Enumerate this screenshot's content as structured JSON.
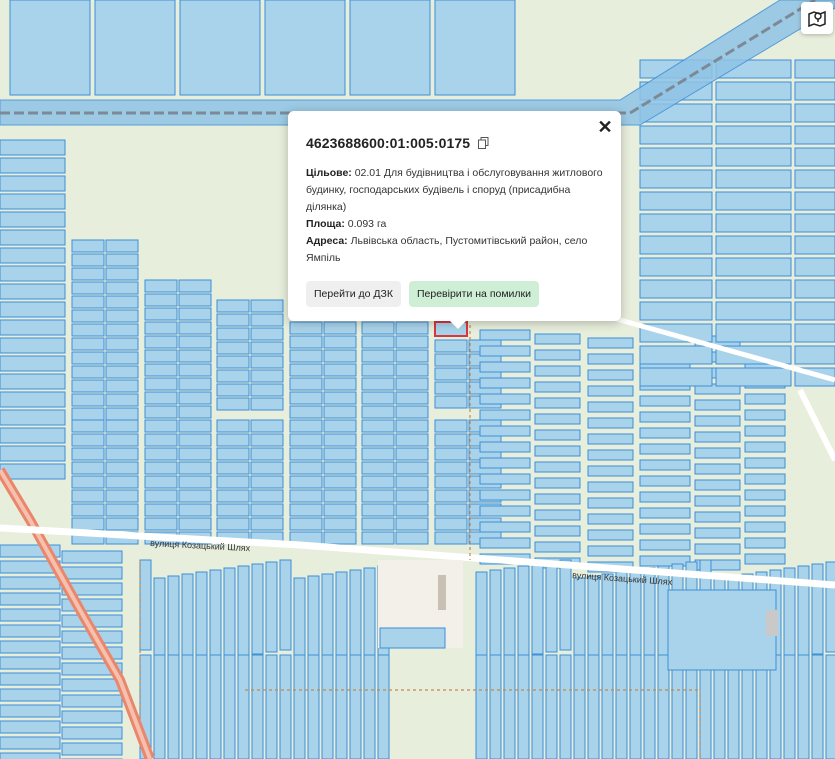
{
  "map": {
    "street_labels": [
      "вулиця Козацький Шлях",
      "вулиця Козацький Шлях"
    ],
    "colors": {
      "background": "#e8eedc",
      "parcel_fill": "#a9d3ea",
      "parcel_stroke": "#3d8fd6",
      "selected_stroke": "#d9363e",
      "road": "#e9866b",
      "railway": "#7d8a96",
      "boundary": "#c4874a"
    }
  },
  "controls": {
    "layers_icon": "map-pin-layers-icon"
  },
  "popup": {
    "cadastral_number": "4623688600:01:005:0175",
    "purpose_label": "Цільове:",
    "purpose_value": "02.01 Для будівництва і обслуговування житлового будинку, господарських будівель і споруд (присадибна ділянка)",
    "area_label": "Площа:",
    "area_value": "0.093 га",
    "address_label": "Адреса:",
    "address_value": "Львівська область, Пустомитівський район, село Ямпіль",
    "btn_dzk": "Перейти до ДЗК",
    "btn_check": "Перевірити на помилки"
  }
}
